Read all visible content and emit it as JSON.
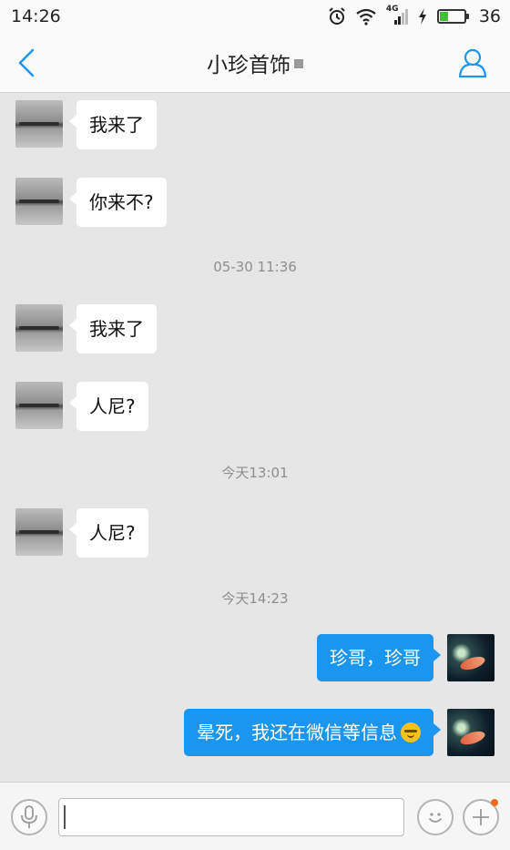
{
  "status_bar": {
    "time": "14:26",
    "network": "4G",
    "battery_level": "36",
    "battery_fraction": 0.36
  },
  "header": {
    "title": "小珍首饰",
    "back_icon": "chevron-left-icon",
    "contact_icon": "person-icon",
    "accent_color": "#1a96f0"
  },
  "messages": [
    {
      "type": "received",
      "text": "我来了"
    },
    {
      "type": "received",
      "text": "你来不?"
    },
    {
      "type": "timestamp",
      "text": "05-30 11:36"
    },
    {
      "type": "received",
      "text": "我来了"
    },
    {
      "type": "received",
      "text": "人尼?"
    },
    {
      "type": "timestamp",
      "text": "今天13:01"
    },
    {
      "type": "received",
      "text": "人尼?"
    },
    {
      "type": "timestamp",
      "text": "今天14:23"
    },
    {
      "type": "sent",
      "text": "珍哥，珍哥"
    },
    {
      "type": "sent",
      "text": "晕死，我还在微信等信息",
      "emoji": "sleepy-face-emoji"
    }
  ],
  "input_bar": {
    "value": "",
    "placeholder": ""
  }
}
